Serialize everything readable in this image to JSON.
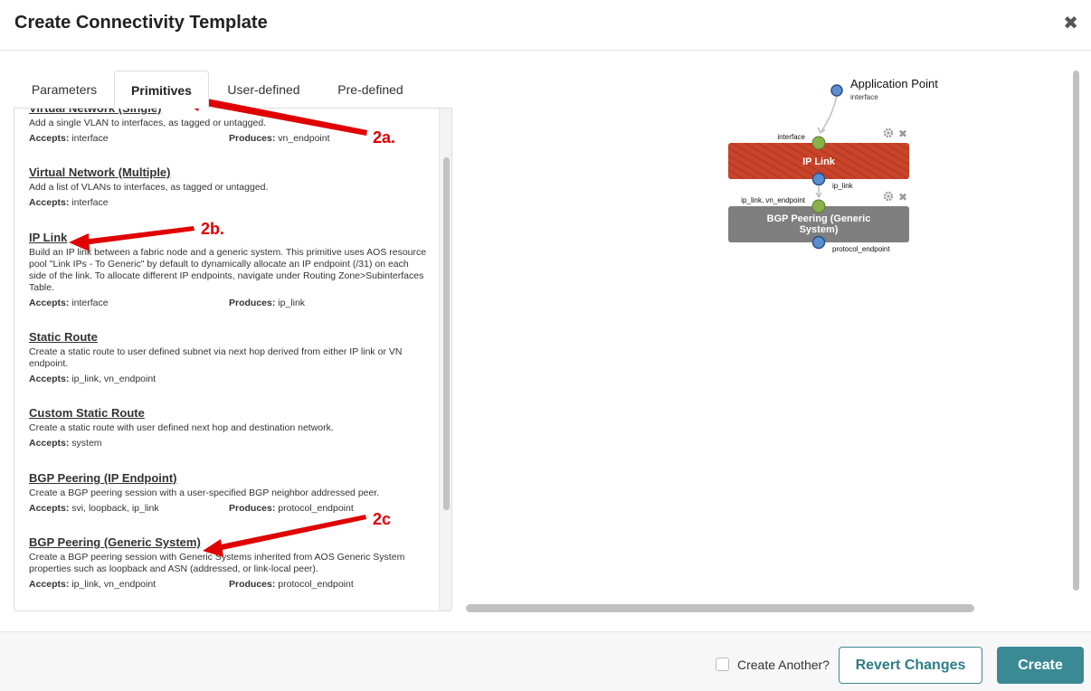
{
  "dialog": {
    "title": "Create Connectivity Template",
    "close_icon": "close-icon"
  },
  "tabs": [
    {
      "label": "Parameters",
      "active": false
    },
    {
      "label": "Primitives",
      "active": true
    },
    {
      "label": "User-defined",
      "active": false
    },
    {
      "label": "Pre-defined",
      "active": false
    }
  ],
  "primitives": [
    {
      "title": "Virtual Network (Single)",
      "description": "Add a single VLAN to interfaces, as tagged or untagged.",
      "accepts_label": "Accepts:",
      "accepts": "interface",
      "produces_label": "Produces:",
      "produces": "vn_endpoint"
    },
    {
      "title": "Virtual Network (Multiple)",
      "description": "Add a list of VLANs to interfaces, as tagged or untagged.",
      "accepts_label": "Accepts:",
      "accepts": "interface",
      "produces_label": "",
      "produces": ""
    },
    {
      "title": "IP Link",
      "description": "Build an IP link between a fabric node and a generic system. This primitive uses AOS resource pool \"Link IPs - To Generic\" by default to dynamically allocate an IP endpoint (/31) on each side of the link. To allocate different IP endpoints, navigate under Routing Zone>Subinterfaces Table.",
      "accepts_label": "Accepts:",
      "accepts": "interface",
      "produces_label": "Produces:",
      "produces": "ip_link"
    },
    {
      "title": "Static Route",
      "description": "Create a static route to user defined subnet via next hop derived from either IP link or VN endpoint.",
      "accepts_label": "Accepts:",
      "accepts": "ip_link, vn_endpoint",
      "produces_label": "",
      "produces": ""
    },
    {
      "title": "Custom Static Route",
      "description": "Create a static route with user defined next hop and destination network.",
      "accepts_label": "Accepts:",
      "accepts": "system",
      "produces_label": "",
      "produces": ""
    },
    {
      "title": "BGP Peering (IP Endpoint)",
      "description": "Create a BGP peering session with a user-specified BGP neighbor addressed peer.",
      "accepts_label": "Accepts:",
      "accepts": "svi, loopback, ip_link",
      "produces_label": "Produces:",
      "produces": "protocol_endpoint"
    },
    {
      "title": "BGP Peering (Generic System)",
      "description": "Create a BGP peering session with Generic Systems inherited from AOS Generic System properties such as loopback and ASN (addressed, or link-local peer).",
      "accepts_label": "Accepts:",
      "accepts": "ip_link, vn_endpoint",
      "produces_label": "Produces:",
      "produces": "protocol_endpoint"
    }
  ],
  "annotations": {
    "a": "2a.",
    "b": "2b.",
    "c": "2c"
  },
  "annotation_color": "#e00000",
  "graph": {
    "app_point_title": "Application Point",
    "app_point_sub": "interface",
    "ip_link_in_label": "interface",
    "ip_link_title": "IP Link",
    "ip_link_out_label": "ip_link",
    "bgp_in_label": "ip_link, vn_endpoint",
    "bgp_title": "BGP Peering (Generic System)",
    "bgp_out_label": "protocol_endpoint",
    "ip_link_color": "#c9442a",
    "bgp_color": "#7f7f7f",
    "input_port_color": "#8ab04a",
    "output_port_color": "#5b8fd0"
  },
  "footer": {
    "create_another": "Create Another?",
    "revert": "Revert Changes",
    "create": "Create"
  }
}
